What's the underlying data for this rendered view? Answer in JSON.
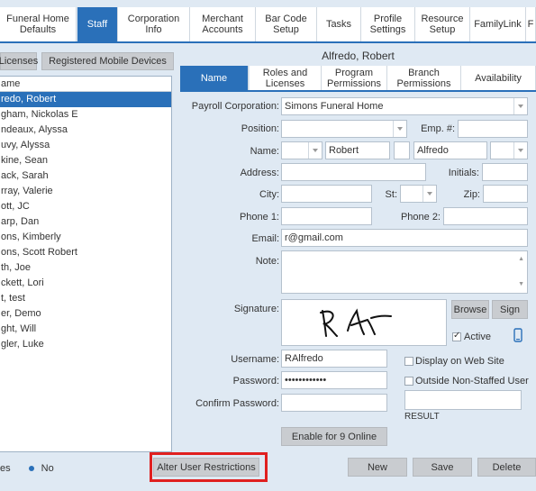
{
  "top_tabs": [
    {
      "label": "Funeral Home\nDefaults"
    },
    {
      "label": "Staff"
    },
    {
      "label": "Corporation\nInfo"
    },
    {
      "label": "Merchant\nAccounts"
    },
    {
      "label": "Bar Code\nSetup"
    },
    {
      "label": "Tasks"
    },
    {
      "label": "Profile\nSettings"
    },
    {
      "label": "Resource\nSetup"
    },
    {
      "label": "FamilyLink"
    },
    {
      "label": "F"
    }
  ],
  "left": {
    "licenses_btn": "Licenses",
    "mobile_btn": "Registered Mobile Devices",
    "list_header": "ame",
    "rows": [
      "redo, Robert",
      "gham, Nickolas E",
      "ndeaux, Alyssa",
      "uvy, Alyssa",
      "kine, Sean",
      "ack, Sarah",
      "rray, Valerie",
      "ott, JC",
      "arp, Dan",
      "ons, Kimberly",
      "ons, Scott Robert",
      "th, Joe",
      "ckett, Lori",
      "t, test",
      "er, Demo",
      "ght, Will",
      "gler, Luke"
    ],
    "radio_yes": "es",
    "radio_no": "No"
  },
  "alter_btn": "Alter User Restrictions",
  "right": {
    "title": "Alfredo, Robert",
    "tabs": [
      "Name",
      "Roles and\nLicenses",
      "Program\nPermissions",
      "Branch\nPermissions",
      "Availability"
    ],
    "labels": {
      "payroll": "Payroll Corporation:",
      "position": "Position:",
      "emp": "Emp. #:",
      "name": "Name:",
      "address": "Address:",
      "initials": "Initials:",
      "city": "City:",
      "st": "St:",
      "zip": "Zip:",
      "phone1": "Phone 1:",
      "phone2": "Phone 2:",
      "email": "Email:",
      "note": "Note:",
      "signature": "Signature:",
      "username": "Username:",
      "password": "Password:",
      "confirm": "Confirm Password:"
    },
    "values": {
      "payroll": "Simons Funeral Home",
      "first": "Robert",
      "last": "Alfredo",
      "email": "r@gmail.com",
      "username": "RAlfredo",
      "password": "••••••••••••"
    },
    "browse": "Browse",
    "sign": "Sign",
    "active": "Active",
    "display_web": "Display on Web Site",
    "outside": "Outside Non-Staffed User",
    "result": "RESULT",
    "enable": "Enable for 9 Online"
  },
  "bottom": {
    "new": "New",
    "save": "Save",
    "delete": "Delete"
  },
  "colors": {
    "accent": "#2a70b9",
    "highlight": "#e02020"
  }
}
